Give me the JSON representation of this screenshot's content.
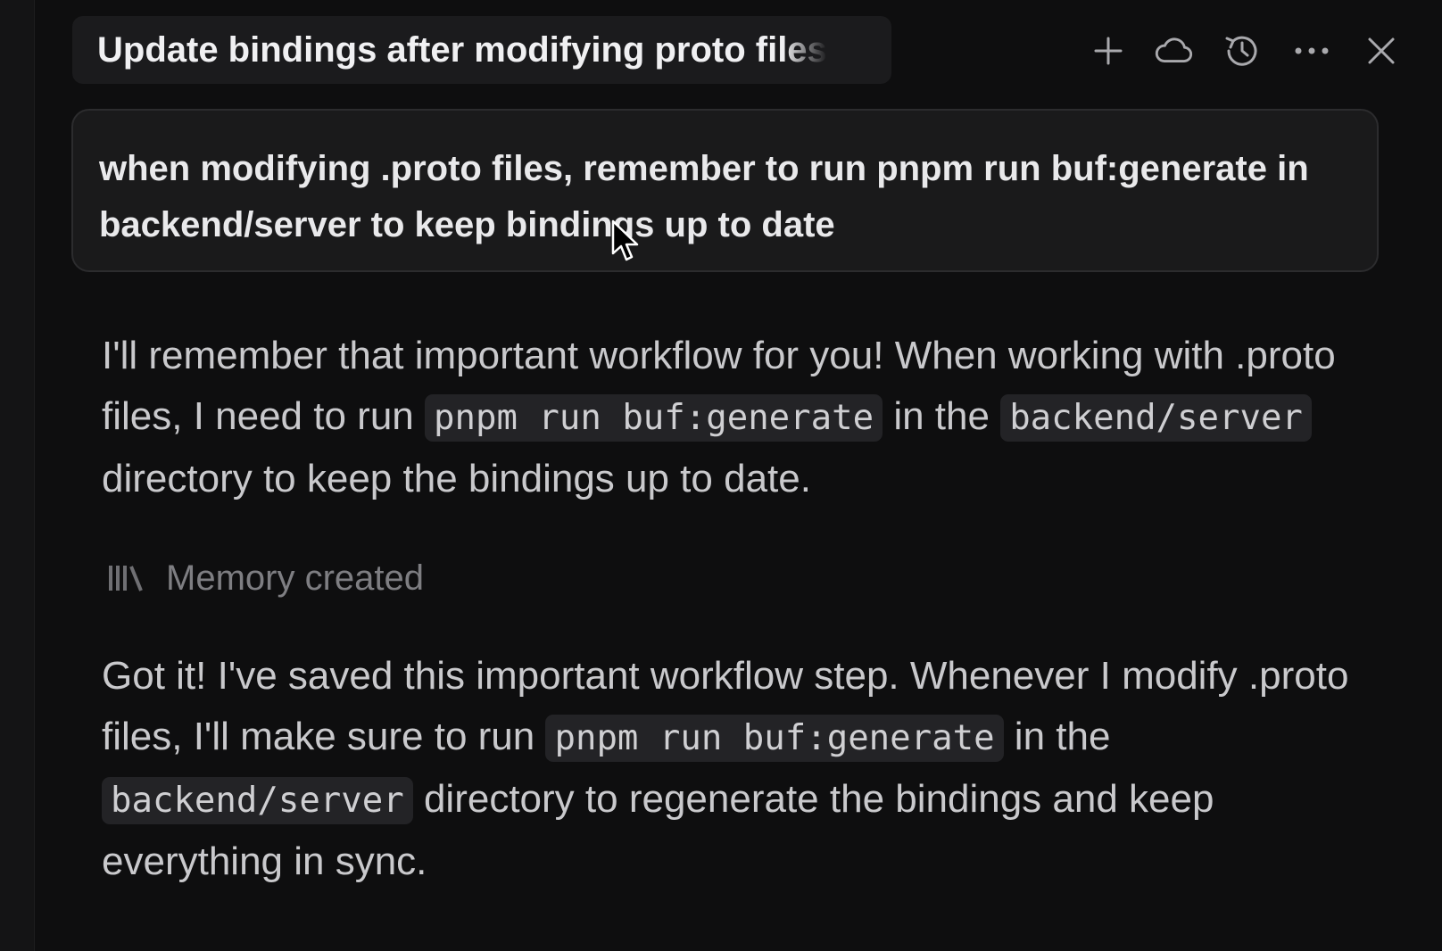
{
  "header": {
    "title": "Update bindings after modifying proto files",
    "actions": [
      {
        "name": "new-chat",
        "icon": "plus-icon"
      },
      {
        "name": "cloud",
        "icon": "cloud-icon"
      },
      {
        "name": "history",
        "icon": "history-icon"
      },
      {
        "name": "more",
        "icon": "more-horizontal-icon"
      },
      {
        "name": "close",
        "icon": "close-icon"
      }
    ]
  },
  "user_message": {
    "text": "when modifying .proto files, remember to run pnpm run buf:generate in backend/server to keep bindings up to date"
  },
  "assistant_message_1": {
    "part1": "I'll remember that important workflow for you! When working with .proto files, I need to run ",
    "code1": "pnpm run buf:generate",
    "part2": " in the ",
    "code2": "backend/server",
    "part3": " directory to keep the bindings up to date."
  },
  "memory_status": {
    "icon": "library-icon",
    "label": "Memory created"
  },
  "assistant_message_2": {
    "part1": "Got it! I've saved this important workflow step. Whenever I modify .proto files, I'll make sure to run ",
    "code1": "pnpm run buf:generate",
    "part2": " in the ",
    "code2": "backend/server",
    "part3": " directory to regenerate the bindings and keep everything in sync."
  },
  "colors": {
    "background": "#0e0e0f",
    "bubble": "#1a1a1b",
    "code_bg": "#232326",
    "text_primary": "#e9e9eb",
    "text_muted": "#7e7e82"
  }
}
